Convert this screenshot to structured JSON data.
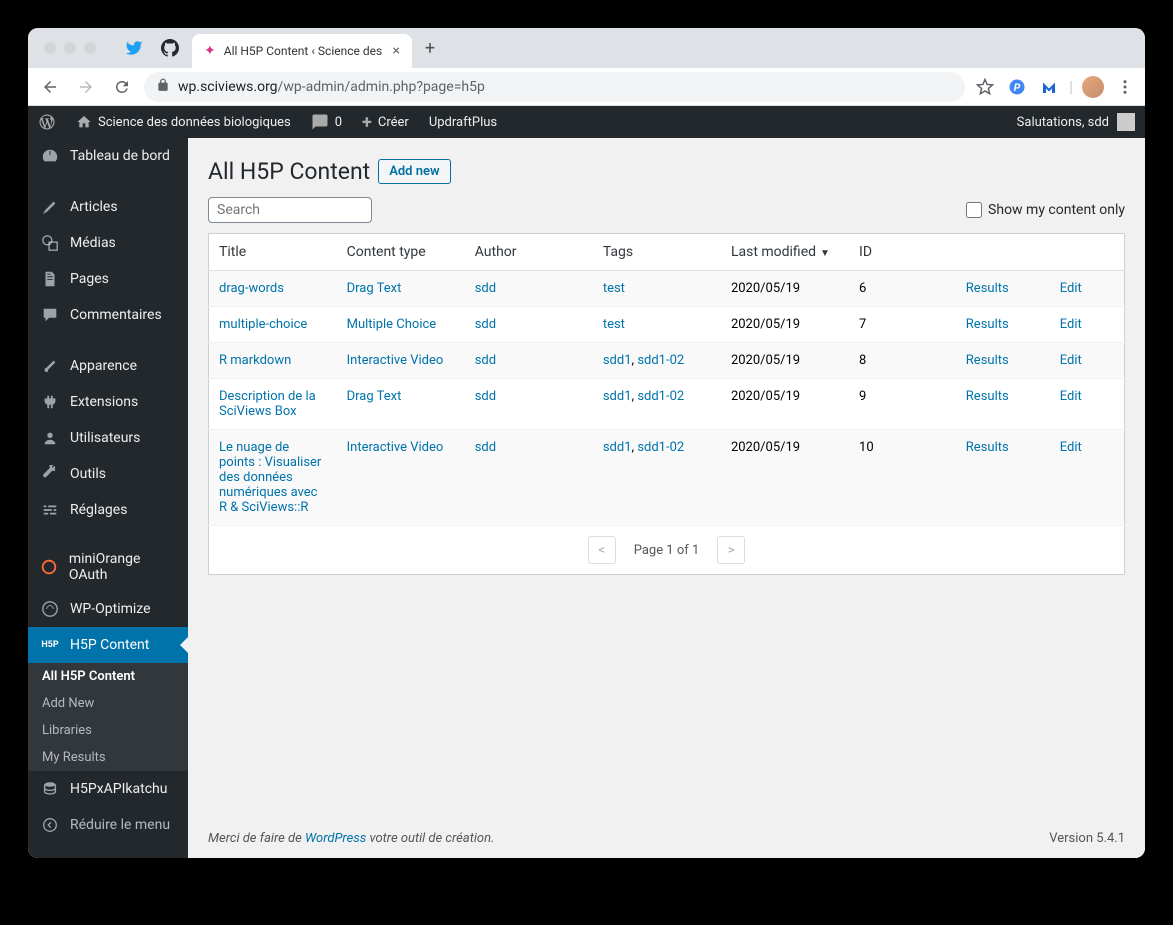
{
  "browser": {
    "tab_title": "All H5P Content ‹ Science des",
    "url_host": "wp.sciviews.org",
    "url_path": "/wp-admin/admin.php?page=h5p"
  },
  "topbar": {
    "site_name": "Science des données biologiques",
    "comments": "0",
    "create": "Créer",
    "updraft": "UpdraftPlus",
    "greeting": "Salutations, sdd"
  },
  "sidebar": {
    "items": [
      {
        "label": "Tableau de bord"
      },
      {
        "label": "Articles"
      },
      {
        "label": "Médias"
      },
      {
        "label": "Pages"
      },
      {
        "label": "Commentaires"
      },
      {
        "label": "Apparence"
      },
      {
        "label": "Extensions"
      },
      {
        "label": "Utilisateurs"
      },
      {
        "label": "Outils"
      },
      {
        "label": "Réglages"
      },
      {
        "label": "miniOrange OAuth"
      },
      {
        "label": "WP-Optimize"
      },
      {
        "label": "H5P Content"
      },
      {
        "label": "H5PxAPIkatchu"
      }
    ],
    "submenu": [
      {
        "label": "All H5P Content"
      },
      {
        "label": "Add New"
      },
      {
        "label": "Libraries"
      },
      {
        "label": "My Results"
      }
    ],
    "collapse": "Réduire le menu"
  },
  "page": {
    "title": "All H5P Content",
    "add_new": "Add new",
    "search_placeholder": "Search",
    "show_mine": "Show my content only"
  },
  "table": {
    "headers": {
      "title": "Title",
      "type": "Content type",
      "author": "Author",
      "tags": "Tags",
      "modified": "Last modified",
      "id": "ID"
    },
    "rows": [
      {
        "title": "drag-words",
        "type": "Drag Text",
        "author": "sdd",
        "tags": [
          "test"
        ],
        "modified": "2020/05/19",
        "id": "6",
        "results": "Results",
        "edit": "Edit"
      },
      {
        "title": "multiple-choice",
        "type": "Multiple Choice",
        "author": "sdd",
        "tags": [
          "test"
        ],
        "modified": "2020/05/19",
        "id": "7",
        "results": "Results",
        "edit": "Edit"
      },
      {
        "title": "R markdown",
        "type": "Interactive Video",
        "author": "sdd",
        "tags": [
          "sdd1",
          "sdd1-02"
        ],
        "modified": "2020/05/19",
        "id": "8",
        "results": "Results",
        "edit": "Edit"
      },
      {
        "title": "Description de la SciViews Box",
        "type": "Drag Text",
        "author": "sdd",
        "tags": [
          "sdd1",
          "sdd1-02"
        ],
        "modified": "2020/05/19",
        "id": "9",
        "results": "Results",
        "edit": "Edit"
      },
      {
        "title": "Le nuage de points : Visualiser des données numériques avec R & SciViews::R",
        "type": "Interactive Video",
        "author": "sdd",
        "tags": [
          "sdd1",
          "sdd1-02"
        ],
        "modified": "2020/05/19",
        "id": "10",
        "results": "Results",
        "edit": "Edit"
      }
    ]
  },
  "pagination": {
    "text": "Page 1 of 1",
    "prev": "<",
    "next": ">"
  },
  "footer": {
    "thanks_prefix": "Merci de faire de ",
    "wp": "WordPress",
    "thanks_suffix": " votre outil de création.",
    "version": "Version 5.4.1"
  }
}
